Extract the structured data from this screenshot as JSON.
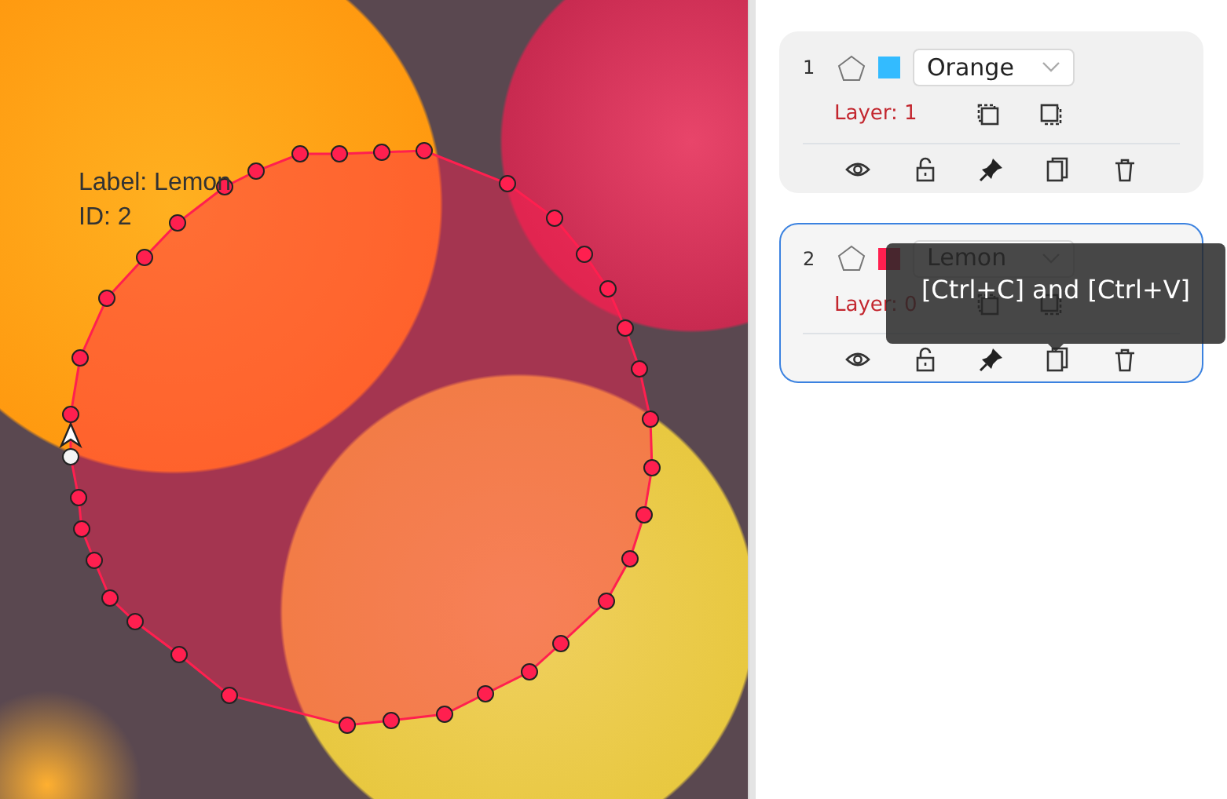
{
  "canvas": {
    "overlay_label": "Label: Lemon",
    "overlay_id": "ID: 2"
  },
  "objects": [
    {
      "number": "1",
      "label": "Orange",
      "color": "#33bbff",
      "layer": "Layer: 1",
      "selected": false
    },
    {
      "number": "2",
      "label": "Lemon",
      "color": "#ff1f4f",
      "layer": "Layer: 0",
      "selected": true
    }
  ],
  "tooltip": {
    "text": "[Ctrl+C] and [Ctrl+V]"
  }
}
